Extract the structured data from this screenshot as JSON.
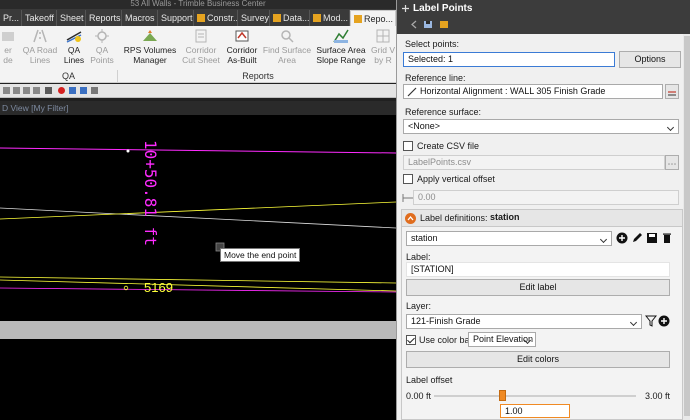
{
  "window": {
    "title": "53 All Walls - Trimble Business Center"
  },
  "tabs": [
    {
      "label": "Pr...",
      "active": false
    },
    {
      "label": "Takeoff",
      "active": false
    },
    {
      "label": "Sheet",
      "active": false
    },
    {
      "label": "Reports",
      "active": false
    },
    {
      "label": "Macros",
      "active": false
    },
    {
      "label": "Support",
      "active": false
    },
    {
      "label": "Constr...",
      "active": false
    },
    {
      "label": "Survey",
      "active": false
    },
    {
      "label": "Data...",
      "active": false
    },
    {
      "label": "Mod...",
      "active": false
    },
    {
      "label": "Repo...",
      "active": true
    }
  ],
  "ribbon": {
    "buttons": [
      {
        "line1": "er",
        "line2": "de",
        "enabled": false
      },
      {
        "line1": "QA Road",
        "line2": "Lines",
        "enabled": false
      },
      {
        "line1": "QA",
        "line2": "Lines",
        "enabled": true
      },
      {
        "line1": "QA",
        "line2": "Points",
        "enabled": false
      },
      {
        "line1": "RPS Volumes",
        "line2": "Manager",
        "enabled": true
      },
      {
        "line1": "Corridor",
        "line2": "Cut Sheet",
        "enabled": false
      },
      {
        "line1": "Corridor",
        "line2": "As-Built",
        "enabled": true
      },
      {
        "line1": "Find Surface",
        "line2": "Area",
        "enabled": false
      },
      {
        "line1": "Surface Area",
        "line2": "Slope Range",
        "enabled": true
      },
      {
        "line1": "Grid V",
        "line2": "by R",
        "enabled": false
      }
    ],
    "groups": [
      "QA",
      "Reports"
    ]
  },
  "view": {
    "title": "D View [My Filter]",
    "station_text": "10+50.81 ft",
    "elevation_text": "5169",
    "tooltip": "Move the end point"
  },
  "panel": {
    "title": "Label Points",
    "select_points_label": "Select points:",
    "selected_value": "Selected: 1",
    "options_button": "Options",
    "reference_line_label": "Reference line:",
    "reference_line_value": "Horizontal Alignment : WALL 305 Finish Grade",
    "reference_surface_label": "Reference surface:",
    "reference_surface_value": "<None>",
    "create_csv_label": "Create CSV file",
    "create_csv_checked": false,
    "csv_placeholder": "LabelPoints.csv",
    "apply_vertical_label": "Apply vertical offset",
    "apply_vertical_checked": false,
    "vertical_offset_value": "0.00",
    "label_definitions_label": "Label definitions:",
    "label_definitions_name": "station",
    "definition_select": "station",
    "label_label": "Label:",
    "label_value": "[STATION]",
    "edit_label_button": "Edit label",
    "layer_label": "Layer:",
    "layer_value": "121-Finish Grade",
    "use_color_band_label": "Use color band",
    "use_color_band_checked": true,
    "color_band_value": "Point Elevation",
    "edit_colors_button": "Edit colors",
    "label_offset_label": "Label offset",
    "offset_min": "0.00 ft",
    "offset_max": "3.00 ft",
    "offset_value": "1.00",
    "offset_fraction": 0.333
  },
  "colors": {
    "accent_orange": "#e5a320",
    "magenta": "#ff2bff",
    "yellow": "#ffff3a",
    "tab_bar": "#3a3a3a",
    "panel_bg": "#f0f0f0"
  }
}
